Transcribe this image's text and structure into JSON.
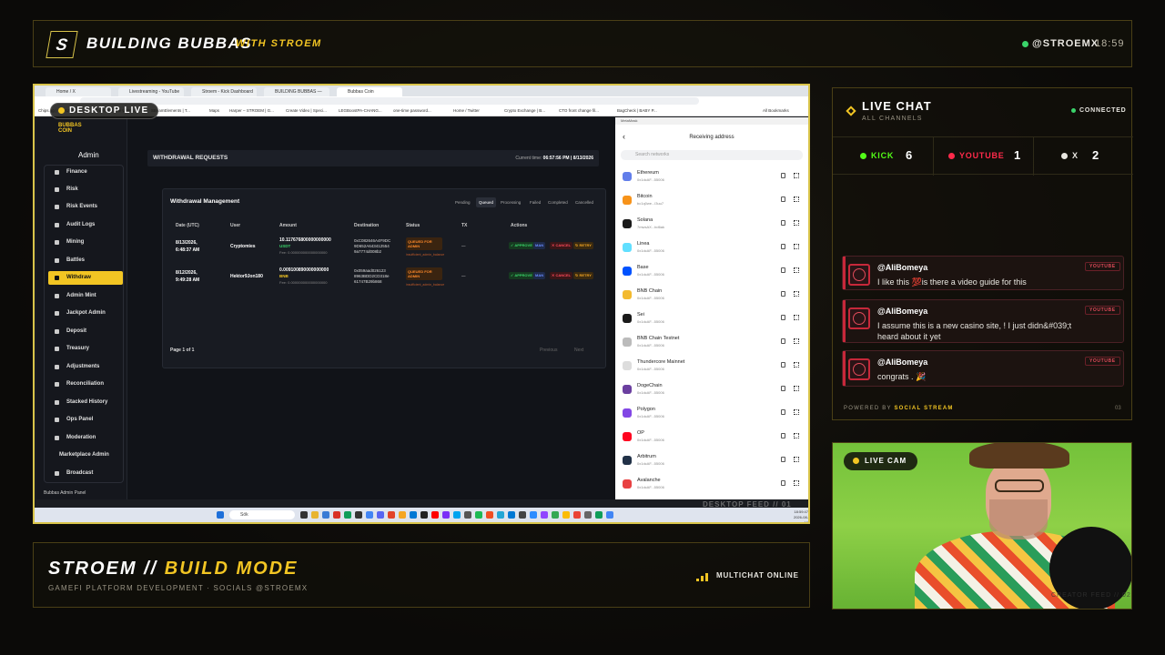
{
  "header": {
    "logo_letter": "S",
    "brand": "BUILDING BUBBAS",
    "brand_sub": "WITH STROEM",
    "handle": "@STROEMX",
    "time": "18:59"
  },
  "desktop": {
    "badge": "DESKTOP LIVE",
    "feed_label": "DESKTOP FEED // 01",
    "browser_tabs": [
      "Home / X",
      "Livestreaming - YouTube Studio",
      "Stroem - Kick Dashboard",
      "BUILDING BUBBAS — STROEM",
      "Bubbas Coin"
    ],
    "bookmarks": [
      "Chips.gg | The Ultim...",
      "Chips.gg | The Ultim...",
      "StreamElements | T...",
      "Maps",
      "Harper – STROEM | G...",
      "Create Video | Speci...",
      "LEGBoostPA-CHANG...",
      "one-time password...",
      "Home / Twitter",
      "Crypto Exchange | B...",
      "CTO front change fil...",
      "BagCheck | BABY P...",
      "All Bookmarks"
    ],
    "app": {
      "logo": "BUBBAS COIN",
      "admin_label": "Admin",
      "nav": [
        "Finance",
        "Risk",
        "Risk Events",
        "Audit Logs",
        "Mining",
        "Battles",
        "Withdraw",
        "Admin Mint",
        "Jackpot Admin",
        "Deposit",
        "Treasury",
        "Adjustments",
        "Reconciliation",
        "Stacked History",
        "Ops Panel",
        "Moderation",
        "Marketplace Admin",
        "Broadcast"
      ],
      "active_nav": "Withdraw",
      "footer": "Bubbas Admin Panel",
      "page_title": "WITHDRAWAL REQUESTS",
      "current_time_label": "Current time:",
      "current_time": "06:57:56 PM | 8/13/2026",
      "card_title": "Withdrawal Management",
      "filters": [
        "Pending",
        "Queued",
        "Processing",
        "Failed",
        "Completed",
        "Cancelled"
      ],
      "active_filter": "Queued",
      "columns": [
        "Date (UTC)",
        "User",
        "Amount",
        "Destination",
        "Status",
        "TX",
        "Actions"
      ],
      "rows": [
        {
          "date": "8/13/2026,",
          "time": "6:48:37 AM",
          "user": "Cryptomies",
          "amount": "10.117676800000000000",
          "token": "USDT",
          "fee": "Fee: 0.000000000000000000",
          "dest1": "0xC082646A4F9DC",
          "dest2": "9D652A643412554",
          "dest3": "9a7774d008b2",
          "status": "QUEUED FOR ADMIN",
          "status_note": "insufficient_admin_balance",
          "tx": "—"
        },
        {
          "date": "8/12/2026,",
          "time": "9:49:28 AM",
          "user": "Hektor9Jon180",
          "amount": "0.009100890000000000",
          "token": "BNB",
          "fee": "Fee: 0.000000000000000000",
          "dest1": "0x059aad026123",
          "dest2": "8963BDD2CD318e",
          "dest3": "61747B29b868",
          "status": "QUEUED FOR ADMIN",
          "status_note": "insufficient_admin_balance",
          "tx": "—"
        }
      ],
      "actions": [
        "✓ APPROVE",
        "MAN",
        "✕ CANCEL",
        "↻ RETRY"
      ],
      "page_info": "Page 1 of 1",
      "prev": "Previous",
      "next": "Next"
    },
    "metamask": {
      "window_title": "MetaMask",
      "title": "Receiving address",
      "search_placeholder": "Search networks",
      "networks": [
        {
          "name": "Ethereum",
          "addr": "0x1dcAF...55006",
          "color": "#627eea"
        },
        {
          "name": "Bitcoin",
          "addr": "bc1q0we...l3uu7",
          "color": "#f7931a"
        },
        {
          "name": "Solana",
          "addr": "7mwsAX...bd6ak",
          "color": "#1a1a1a"
        },
        {
          "name": "Linea",
          "addr": "0x1dcAF...55006",
          "color": "#61dfff"
        },
        {
          "name": "Base",
          "addr": "0x1dcAF...55006",
          "color": "#0052ff"
        },
        {
          "name": "BNB Chain",
          "addr": "0x1dcAF...55006",
          "color": "#f3ba2f"
        },
        {
          "name": "Sei",
          "addr": "0x1dcAF...55006",
          "color": "#1a1a1a"
        },
        {
          "name": "BNB Chain Testnet",
          "addr": "0x1dcAF...55006",
          "color": "#bbbbbb"
        },
        {
          "name": "Thundercore Mainnet",
          "addr": "0x1dcAF...55006",
          "color": "#dddddd"
        },
        {
          "name": "DogeChain",
          "addr": "0x1dcAF...55006",
          "color": "#6b3fa0"
        },
        {
          "name": "Polygon",
          "addr": "0x1dcAF...55006",
          "color": "#8247e5"
        },
        {
          "name": "OP",
          "addr": "0x1dcAF...55006",
          "color": "#ff0420"
        },
        {
          "name": "Arbitrum",
          "addr": "0x1dcAF...55006",
          "color": "#213147"
        },
        {
          "name": "Avalanche",
          "addr": "0x1dcAF...55006",
          "color": "#e84142"
        }
      ]
    },
    "taskbar": {
      "search": "Sök",
      "time": "18:59:47",
      "date": "2026-08-13"
    }
  },
  "chat": {
    "title": "LIVE CHAT",
    "subtitle": "ALL CHANNELS",
    "status": "CONNECTED",
    "platforms": [
      {
        "label": "KICK",
        "count": "6",
        "color": "#53fc18"
      },
      {
        "label": "YOUTUBE",
        "count": "1",
        "color": "#ff2a4a"
      },
      {
        "label": "X",
        "count": "2",
        "color": "#e8e6e0"
      }
    ],
    "messages": [
      {
        "user": "@AliBomeya",
        "text": "I like this 💯is there a video guide for this",
        "platform": "YOUTUBE"
      },
      {
        "user": "@AliBomeya",
        "text": "I assume this is a new casino site, ! I just didn&#039;t heard about it yet",
        "platform": "YOUTUBE"
      },
      {
        "user": "@AliBomeya",
        "text": "congrats . 🎉",
        "platform": "YOUTUBE"
      }
    ],
    "powered_by": "POWERED BY",
    "powered_name": "SOCIAL STREAM",
    "panel_num": "03"
  },
  "cam": {
    "badge": "LIVE CAM",
    "feed_label": "CREATOR FEED // 02"
  },
  "lower": {
    "title_a": "STROEM //",
    "title_b": "BUILD MODE",
    "subtitle": "GAMEFI PLATFORM DEVELOPMENT · SOCIALS @STROEMX",
    "multichat": "MULTICHAT ONLINE"
  },
  "colors": {
    "accent": "#f2c523",
    "connected": "#3ad36a",
    "youtube": "#ff2a4a",
    "kick": "#53fc18"
  }
}
